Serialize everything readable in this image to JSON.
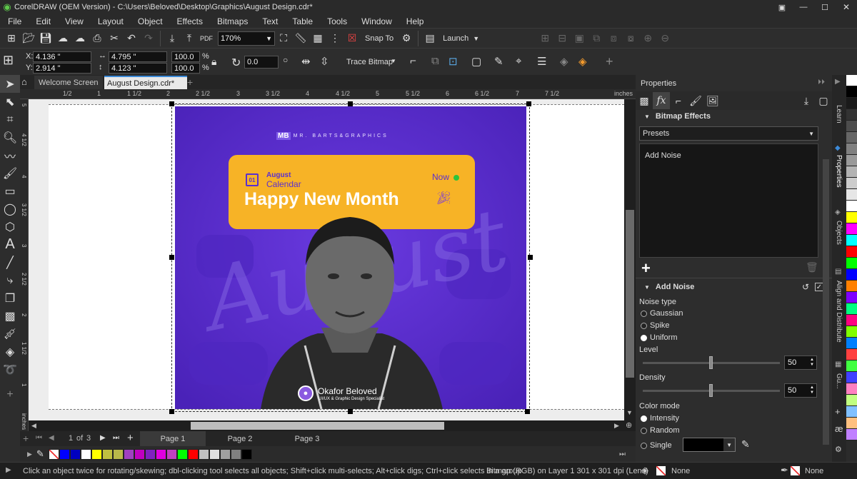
{
  "app": {
    "title": "CorelDRAW (OEM Version) - C:\\Users\\Beloved\\Desktop\\Graphics\\August Design.cdr*"
  },
  "menu": [
    "File",
    "Edit",
    "View",
    "Layout",
    "Object",
    "Effects",
    "Bitmaps",
    "Text",
    "Table",
    "Tools",
    "Window",
    "Help"
  ],
  "toolbar": {
    "zoom": "170%",
    "snap_to": "Snap To",
    "launch": "Launch"
  },
  "propbar": {
    "x": "4.136 \"",
    "y": "2.914 \"",
    "w": "4.795 \"",
    "h": "4.123 \"",
    "scale_w": "100.0",
    "scale_h": "100.0",
    "pct": "%",
    "angle": "0.0",
    "trace_bitmap": "Trace Bitmap"
  },
  "doc_tabs": [
    "Welcome Screen",
    "August Design.cdr*"
  ],
  "ruler": {
    "labels": [
      "1/2",
      "1",
      "1 1/2",
      "2",
      "2 1/2",
      "3",
      "3 1/2",
      "4",
      "4 1/2",
      "5",
      "5 1/2",
      "6",
      "6 1/2",
      "7",
      "7 1/2"
    ],
    "unit": "inches",
    "vlabels": [
      "5",
      "4 1/2",
      "4",
      "3 1/2",
      "3",
      "2 1/2",
      "2",
      "1 1/2",
      "1"
    ]
  },
  "artwork": {
    "brand": "MR. BARTS&GRAPHICS",
    "day": "01",
    "month": "August",
    "calendar": "Calendar",
    "now": "Now",
    "headline": "Happy New Month",
    "bg_word": "August",
    "person_name": "Okafor Beloved",
    "person_title": "UI/UX & Graphic Design Specialist",
    "colors": {
      "purple": "#5b2fd0",
      "yellow": "#f7b326"
    }
  },
  "pages": {
    "current": "1",
    "of": "of",
    "total": "3",
    "tabs": [
      "Page 1",
      "Page 2",
      "Page 3"
    ]
  },
  "palette_colors": [
    "#0000ff",
    "#0000c0",
    "#ffffff",
    "#ffff00",
    "#c0c040",
    "#b9b94a",
    "#a040c0",
    "#c000c0",
    "#8020c0",
    "#e000e0",
    "#c040c0",
    "#00ff00",
    "#ff0000",
    "#c0c0c0",
    "#e0e0e0",
    "#a0a0a0",
    "#808080",
    "#000000"
  ],
  "right_palette": [
    "#ffffff",
    "#000000",
    "#1a1a1a",
    "#333333",
    "#4d4d4d",
    "#666666",
    "#808080",
    "#999999",
    "#b3b3b3",
    "#cccccc",
    "#e6e6e6",
    "#ffffff",
    "#ffff00",
    "#ff00ff",
    "#00ffff",
    "#ff0000",
    "#00ff00",
    "#0000ff",
    "#ff8000",
    "#8000ff",
    "#00ff80",
    "#ff0080",
    "#80ff00",
    "#0080ff",
    "#ff4040",
    "#40ff40",
    "#4040ff",
    "#ff80c0",
    "#c0ff80",
    "#80c0ff",
    "#ffc080",
    "#c080ff"
  ],
  "status": {
    "hint": "Click an object twice for rotating/skewing; dbl-clicking tool selects all objects; Shift+click multi-selects; Alt+click digs; Ctrl+click selects in a group",
    "object": "Bitmap (RGB) on Layer 1  301 x 301 dpi (Lens)",
    "fill": "None",
    "outline": "None"
  },
  "properties": {
    "title": "Properties",
    "section": "Bitmap Effects",
    "presets": "Presets",
    "effect_item": "Add Noise",
    "effect_header": "Add Noise",
    "noise_type_label": "Noise type",
    "noise_types": [
      "Gaussian",
      "Spike",
      "Uniform"
    ],
    "noise_selected": "Uniform",
    "level_label": "Level",
    "level": "50",
    "level_value": 50,
    "density_label": "Density",
    "density": "50",
    "density_value": 50,
    "color_mode_label": "Color mode",
    "color_modes": [
      "Intensity",
      "Random",
      "Single"
    ],
    "color_mode_selected": "Intensity"
  },
  "dock_tabs": [
    "Learn",
    "Properties",
    "Objects",
    "Align and Distribute",
    "Gu..."
  ]
}
